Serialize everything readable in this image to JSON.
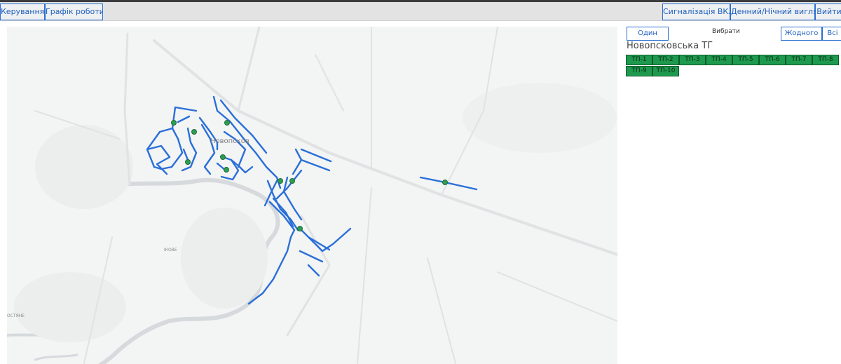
{
  "toolbar": {
    "left": [
      "Керування",
      "Графік роботи"
    ],
    "right": [
      "Сигналізація ВКЛ",
      "Денний/Нічний вигляд",
      "Вийти"
    ]
  },
  "map": {
    "labels": {
      "town": "Новопсков",
      "place1": "ІКОВЕ",
      "place2": "ОСТЯНЕ"
    },
    "line_color": "#2a6fd8",
    "node_color": "#2e9e52"
  },
  "panel": {
    "one_label": "Один",
    "select_label": "Вибрати",
    "none_label": "Жодного",
    "all_label": "Всі",
    "region_title": "Новопсковська ТГ",
    "tp_items": [
      "ТП-1",
      "ТП-2",
      "ТП-3",
      "ТП-4",
      "ТП-5",
      "ТП-6",
      "ТП-7",
      "ТП-8",
      "ТП-9",
      "ТП-10"
    ],
    "tp_color": "#1e9a4e"
  }
}
